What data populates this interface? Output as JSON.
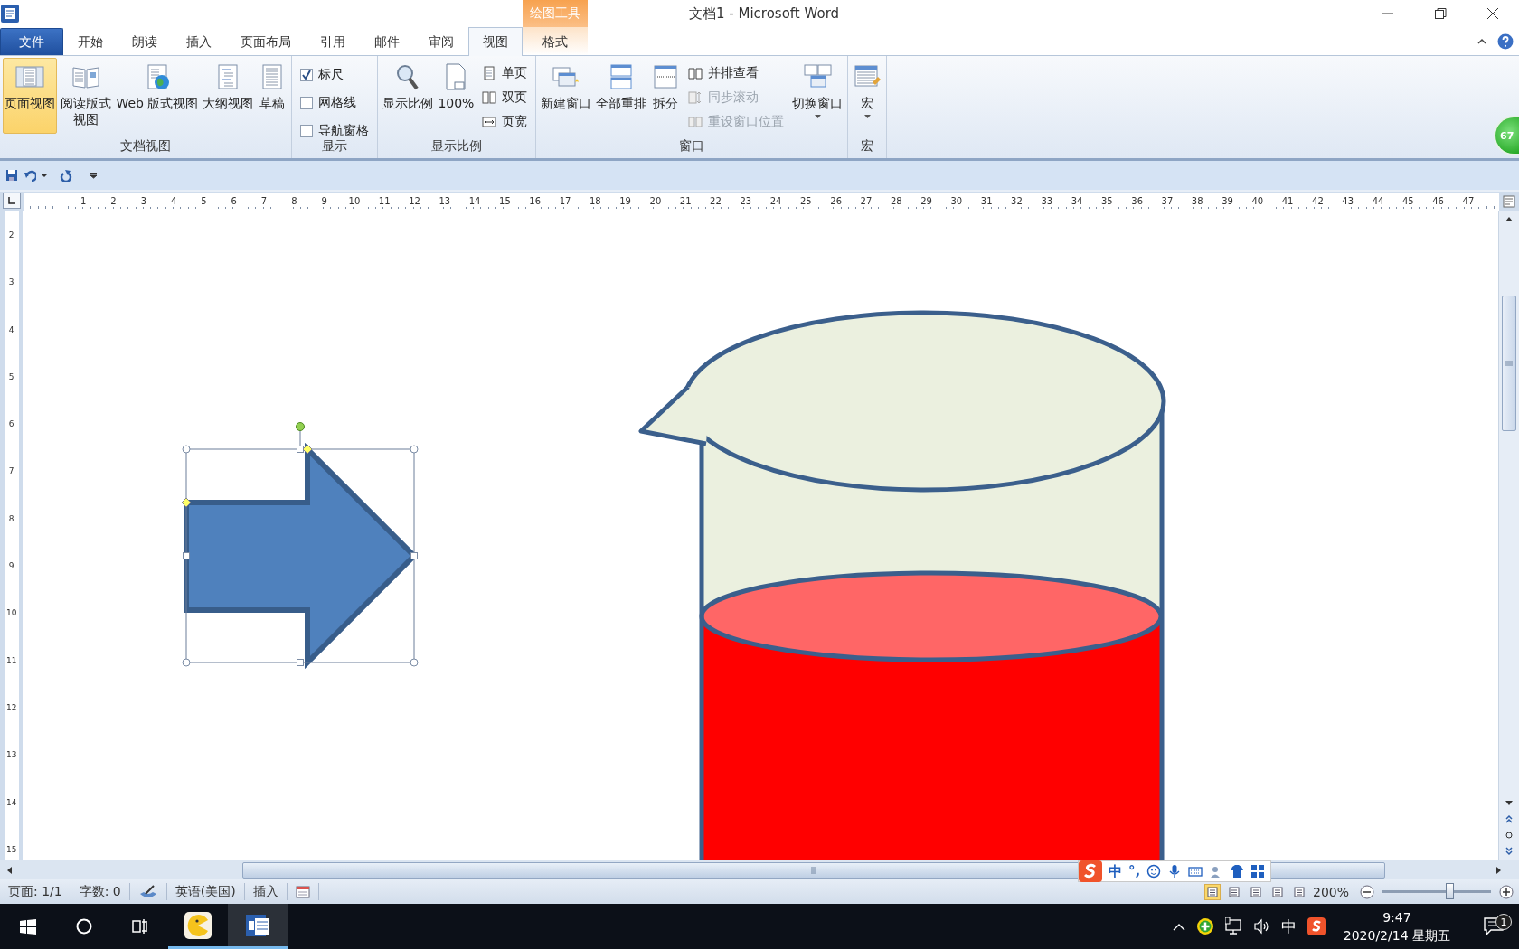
{
  "window": {
    "title": "文档1 - Microsoft Word"
  },
  "tabs": [
    {
      "label": "文件",
      "kind": "file",
      "selected": false
    },
    {
      "label": "开始",
      "kind": "normal",
      "selected": false
    },
    {
      "label": "朗读",
      "kind": "normal",
      "selected": false
    },
    {
      "label": "插入",
      "kind": "normal",
      "selected": false
    },
    {
      "label": "页面布局",
      "kind": "normal",
      "selected": false
    },
    {
      "label": "引用",
      "kind": "normal",
      "selected": false
    },
    {
      "label": "邮件",
      "kind": "normal",
      "selected": false
    },
    {
      "label": "审阅",
      "kind": "normal",
      "selected": false
    },
    {
      "label": "视图",
      "kind": "normal",
      "selected": true
    },
    {
      "label": "格式",
      "kind": "contextual",
      "group": "绘图工具",
      "selected": false
    }
  ],
  "ribbon": {
    "groups": [
      {
        "label": "文档视图",
        "items": [
          {
            "kind": "large",
            "label": "页面视图",
            "selected": true
          },
          {
            "kind": "large",
            "label": "阅读版式视图",
            "selected": false
          },
          {
            "kind": "large",
            "label": "Web 版式视图",
            "selected": false
          },
          {
            "kind": "large",
            "label": "大纲视图",
            "selected": false
          },
          {
            "kind": "large",
            "label": "草稿",
            "selected": false
          }
        ]
      },
      {
        "label": "显示",
        "items": [
          {
            "kind": "checkbox",
            "label": "标尺",
            "checked": true
          },
          {
            "kind": "checkbox",
            "label": "网格线",
            "checked": false
          },
          {
            "kind": "checkbox",
            "label": "导航窗格",
            "checked": false
          }
        ]
      },
      {
        "label": "显示比例",
        "items": [
          {
            "kind": "large",
            "label": "显示比例"
          },
          {
            "kind": "large",
            "label": "100%"
          },
          {
            "kind": "small",
            "label": "单页",
            "disabled": false
          },
          {
            "kind": "small",
            "label": "双页",
            "disabled": false
          },
          {
            "kind": "small",
            "label": "页宽",
            "disabled": false
          }
        ]
      },
      {
        "label": "窗口",
        "items": [
          {
            "kind": "large",
            "label": "新建窗口"
          },
          {
            "kind": "large",
            "label": "全部重排"
          },
          {
            "kind": "large",
            "label": "拆分"
          },
          {
            "kind": "small",
            "label": "并排查看",
            "disabled": false
          },
          {
            "kind": "small",
            "label": "同步滚动",
            "disabled": true
          },
          {
            "kind": "small",
            "label": "重设窗口位置",
            "disabled": true
          },
          {
            "kind": "large",
            "label": "切换窗口",
            "dropdown": true
          }
        ]
      },
      {
        "label": "宏",
        "items": [
          {
            "kind": "large",
            "label": "宏",
            "dropdown": true
          }
        ]
      }
    ]
  },
  "floating_badge": {
    "text": "67"
  },
  "ruler": {
    "horizontal": [
      "1",
      "2",
      "3",
      "4",
      "5",
      "6",
      "7",
      "8",
      "9",
      "10",
      "11",
      "12",
      "13",
      "14",
      "15",
      "16",
      "17",
      "18",
      "19",
      "20",
      "21",
      "22",
      "23",
      "24",
      "25",
      "26",
      "27",
      "28",
      "29",
      "30",
      "31",
      "32",
      "33",
      "34",
      "35",
      "36",
      "37",
      "38",
      "39",
      "40",
      "41",
      "42",
      "43",
      "44",
      "45",
      "46",
      "47"
    ],
    "vertical": [
      "2",
      "3",
      "4",
      "5",
      "6",
      "7",
      "8",
      "9",
      "10",
      "11",
      "12",
      "13",
      "14",
      "15"
    ]
  },
  "ime_toolbar": {
    "mode": "中",
    "punctuation": "°,"
  },
  "status_bar": {
    "page": "页面: 1/1",
    "words": "字数: 0",
    "language": "英语(美国)",
    "mode": "插入",
    "zoom": "200%"
  },
  "zoom_slider": {
    "level": 0.62
  },
  "taskbar": {
    "apps": [
      {
        "kind": "game",
        "selected": false
      },
      {
        "kind": "word",
        "selected": true
      }
    ],
    "tray": {
      "ime": "中",
      "time": "9:47",
      "date": "2020/2/14 星期五",
      "notifications": "1"
    }
  }
}
